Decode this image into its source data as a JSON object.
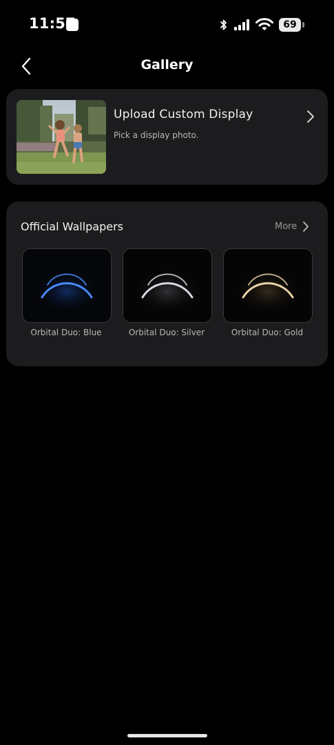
{
  "status_bar": {
    "time": "11:57",
    "battery": "69"
  },
  "header": {
    "title": "Gallery"
  },
  "upload": {
    "title": "Upload Custom Display",
    "subtitle": "Pick a display photo."
  },
  "wallpapers": {
    "title": "Official Wallpapers",
    "more_label": "More",
    "items": [
      {
        "label": "Orbital Duo: Blue",
        "color": "#4a8cff"
      },
      {
        "label": "Orbital Duo: Silver",
        "color": "#d8d8e0"
      },
      {
        "label": "Orbital Duo: Gold",
        "color": "#e8d2a8"
      }
    ]
  },
  "icons": {
    "back": "chevron-left-icon",
    "forward": "chevron-right-icon",
    "bluetooth": "bluetooth-icon",
    "signal": "cellular-signal-icon",
    "wifi": "wifi-icon"
  }
}
